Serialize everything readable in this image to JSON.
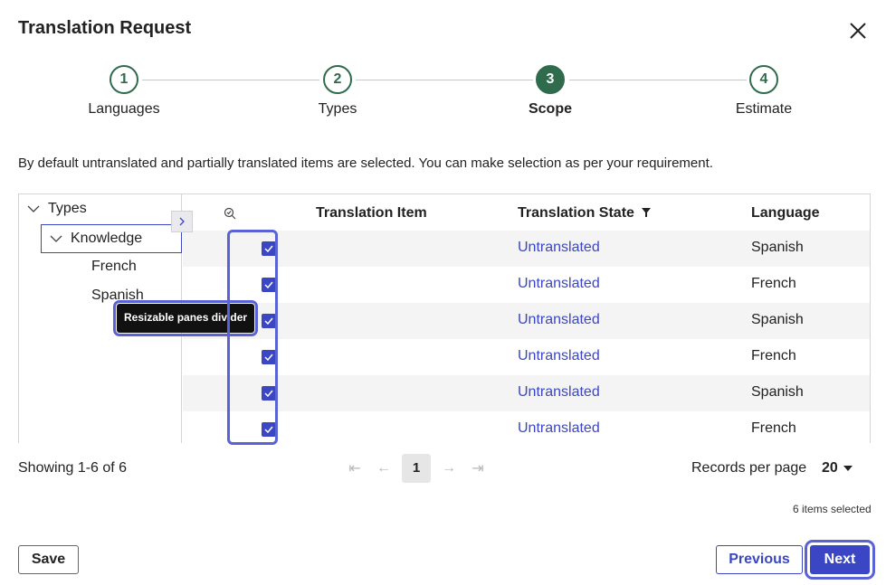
{
  "dialog": {
    "title": "Translation Request"
  },
  "stepper": {
    "steps": [
      {
        "number": "1",
        "label": "Languages"
      },
      {
        "number": "2",
        "label": "Types"
      },
      {
        "number": "3",
        "label": "Scope",
        "active": true
      },
      {
        "number": "4",
        "label": "Estimate"
      }
    ]
  },
  "info_text": "By default untranslated and partially translated items are selected. You can make selection as per your requirement.",
  "tree": {
    "root": "Types",
    "node": "Knowledge",
    "children": [
      "French",
      "Spanish"
    ]
  },
  "tooltip": "Resizable panes divider",
  "grid": {
    "columns": [
      "Translation Item",
      "Translation State",
      "Language"
    ],
    "rows": [
      {
        "item": "",
        "state": "Untranslated",
        "language": "Spanish",
        "checked": true
      },
      {
        "item": "",
        "state": "Untranslated",
        "language": "French",
        "checked": true
      },
      {
        "item": "",
        "state": "Untranslated",
        "language": "Spanish",
        "checked": true
      },
      {
        "item": "",
        "state": "Untranslated",
        "language": "French",
        "checked": true
      },
      {
        "item": "",
        "state": "Untranslated",
        "language": "Spanish",
        "checked": true
      },
      {
        "item": "",
        "state": "Untranslated",
        "language": "French",
        "checked": true
      }
    ]
  },
  "pagination": {
    "showing": "Showing 1-6 of 6",
    "current_page": "1",
    "records_per_page_label": "Records per page",
    "records_per_page": "20"
  },
  "selection": {
    "count_text": "6 items selected"
  },
  "buttons": {
    "save": "Save",
    "previous": "Previous",
    "next": "Next"
  },
  "colors": {
    "accent": "#3b46c4",
    "step_active": "#2f6b4c",
    "focus": "#5a63d6"
  }
}
